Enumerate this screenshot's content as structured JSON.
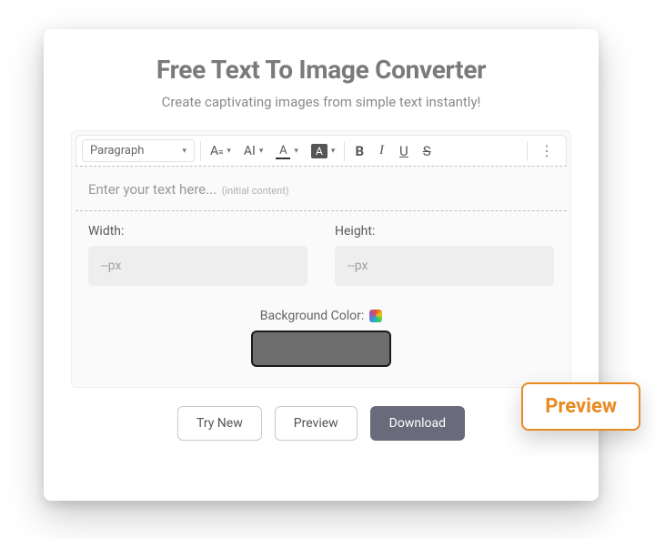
{
  "header": {
    "title": "Free Text To Image Converter",
    "subtitle": "Create captivating images from simple text instantly!"
  },
  "toolbar": {
    "paragraph_label": "Paragraph",
    "font_family_label": "A",
    "font_size_label": "AI",
    "font_color_label": "A",
    "highlight_label": "A",
    "bold": "B",
    "italic": "I",
    "underline": "U",
    "strike": "S",
    "more": "⋮"
  },
  "editor": {
    "placeholder": "Enter your text here...",
    "hint": "(initial content)"
  },
  "dimensions": {
    "width_label": "Width:",
    "width_placeholder": "--px",
    "width_value": "",
    "height_label": "Height:",
    "height_placeholder": "--px",
    "height_value": ""
  },
  "background": {
    "label": "Background Color:",
    "value": "#6e6e6e"
  },
  "buttons": {
    "try_new": "Try New",
    "preview": "Preview",
    "download": "Download"
  },
  "badge": {
    "preview": "Preview"
  }
}
